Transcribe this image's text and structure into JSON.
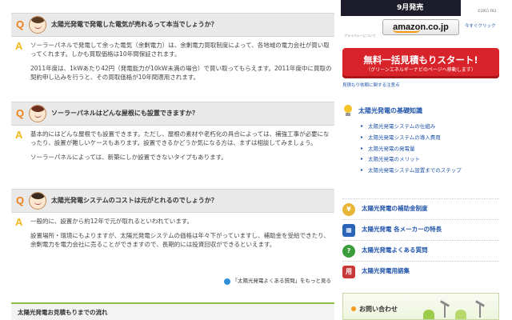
{
  "faq": [
    {
      "question": "太陽光発電で発電した電気が売れるって本当でしょうか？",
      "answer": [
        "ソーラーパネルで発電して余った電気（余剰電力）は、余剰電力買取制度によって、各地域の電力会社が買い取ってくれます。しかも買取価格は10年間保証されます。",
        "2011年度は、1kWあたり42円（発電能力が10kW未満の場合）で買い取ってもらえます。2011年度中に買取の契約申し込みを行うと、その買取価格が10年間適用されます。"
      ]
    },
    {
      "question": "ソーラーパネルはどんな屋根にも設置できますか？",
      "answer": [
        "基本的にはどんな屋根でも設置できます。ただし、屋根の素材や老朽化の具合によっては、補強工事が必要になったり、設置が難しいケースもあります。設置できるかどうか気になる方は、まずは相談してみましょう。",
        "ソーラーパネルによっては、新築にしか設置できないタイプもあります。"
      ]
    },
    {
      "question": "太陽光発電システムのコストは元がとれるのでしょうか？",
      "answer": [
        "一般的に、設置から約12年で元が取れるといわれています。",
        "設置場所・環境にもよりますが、太陽光発電システムの価格は年々下がっていますし、補助金を受給できたり、余剰電力を電力会社に売ることができますので、長期的には投資回収ができるといえます。"
      ]
    }
  ],
  "more_link": "「太陽光発電よくある質問」をもっと見る",
  "flow_heading": "太陽光発電お見積もりまでの流れ",
  "sidebar": {
    "release": "9月発売",
    "copyright": "©2011 F03",
    "amazon_logo": "amazon.co.jp",
    "buy_now": "今すぐクリック",
    "privacy": "プライバシーについて",
    "estimate_button": "無料一括見積もりスタート!",
    "estimate_sub": "（グリーンエネルギーナビのページへ移動します）",
    "note_link": "見積もり依頼に関する注意点",
    "knowledge_title": "太陽光発電の基礎知識",
    "knowledge_items": [
      "太陽光発電システムの仕組み",
      "太陽光発電システムの導入費用",
      "太陽光発電の発電量",
      "太陽光発電のメリット",
      "太陽光発電システム設置までのステップ"
    ],
    "links": [
      {
        "label": "太陽光発電の補助金制度",
        "icon": "coin-icon"
      },
      {
        "label": "太陽光発電 各メーカーの特長",
        "icon": "grid-icon"
      },
      {
        "label": "太陽光発電よくある質問",
        "icon": "question-icon"
      },
      {
        "label": "太陽光発電用語集",
        "icon": "glossary-icon"
      }
    ],
    "contact": "お問い合わせ"
  }
}
